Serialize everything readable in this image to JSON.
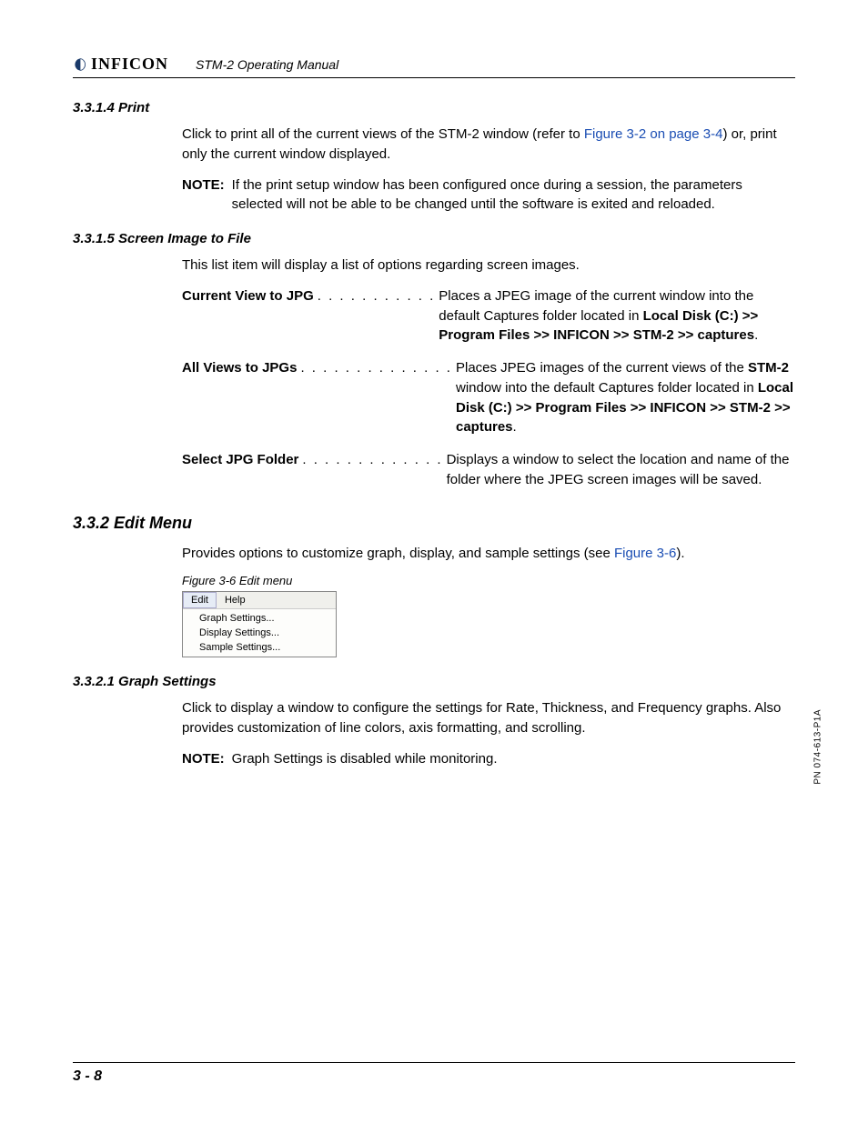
{
  "header": {
    "brand": "INFICON",
    "manual_title": "STM-2 Operating Manual"
  },
  "s3314": {
    "heading": "3.3.1.4  Print",
    "p1_a": "Click to print all of the current views of the STM-2 window (refer to ",
    "p1_link": "Figure 3-2 on page 3-4",
    "p1_b": ") or, print only the current window displayed.",
    "note_label": "NOTE:",
    "note_text": "If the print setup window has been configured once during a session, the parameters selected will not be able to be changed until the software is exited and reloaded."
  },
  "s3315": {
    "heading": "3.3.1.5  Screen Image to File",
    "intro": "This list item will display a list of options regarding screen images.",
    "items": [
      {
        "term": "Current View to JPG",
        "dots": " . . . . . . . . . . .",
        "desc_a": "Places a JPEG image of the current window into the default Captures folder located in ",
        "desc_b": "Local Disk (C:) >> Program Files >> INFICON >> STM-2 >> captures",
        "desc_c": "."
      },
      {
        "term": "All Views to JPGs",
        "dots": ". . . . . . . . . . . . . .",
        "desc_a": "Places JPEG images of the current views of the ",
        "desc_b1": "STM-2",
        "desc_mid": " window into the default Captures folder located in ",
        "desc_b2": "Local Disk (C:) >> Program Files >> INFICON >> STM-2 >> captures",
        "desc_c": "."
      },
      {
        "term": "Select JPG Folder",
        "dots": " . . . . . . . . . . . . .",
        "desc_a": "Displays a window to select the location and name of the folder where the JPEG screen images will be saved.",
        "desc_b": "",
        "desc_c": ""
      }
    ]
  },
  "s332": {
    "heading": "3.3.2  Edit Menu",
    "p1_a": "Provides options to customize graph, display, and sample settings (see ",
    "p1_link": "Figure 3-6",
    "p1_b": ").",
    "figure_caption": "Figure 3-6  Edit menu",
    "menu": {
      "tabs": [
        "Edit",
        "Help"
      ],
      "items": [
        "Graph Settings...",
        "Display Settings...",
        "Sample Settings..."
      ]
    }
  },
  "s3321": {
    "heading": "3.3.2.1  Graph Settings",
    "p1": "Click to display a window to configure the settings for Rate, Thickness, and Frequency graphs. Also provides customization of line colors, axis formatting, and scrolling.",
    "note_label": "NOTE:",
    "note_text": "Graph Settings is disabled while monitoring."
  },
  "side_label": "PN 074-613-P1A",
  "page_number": "3 - 8"
}
